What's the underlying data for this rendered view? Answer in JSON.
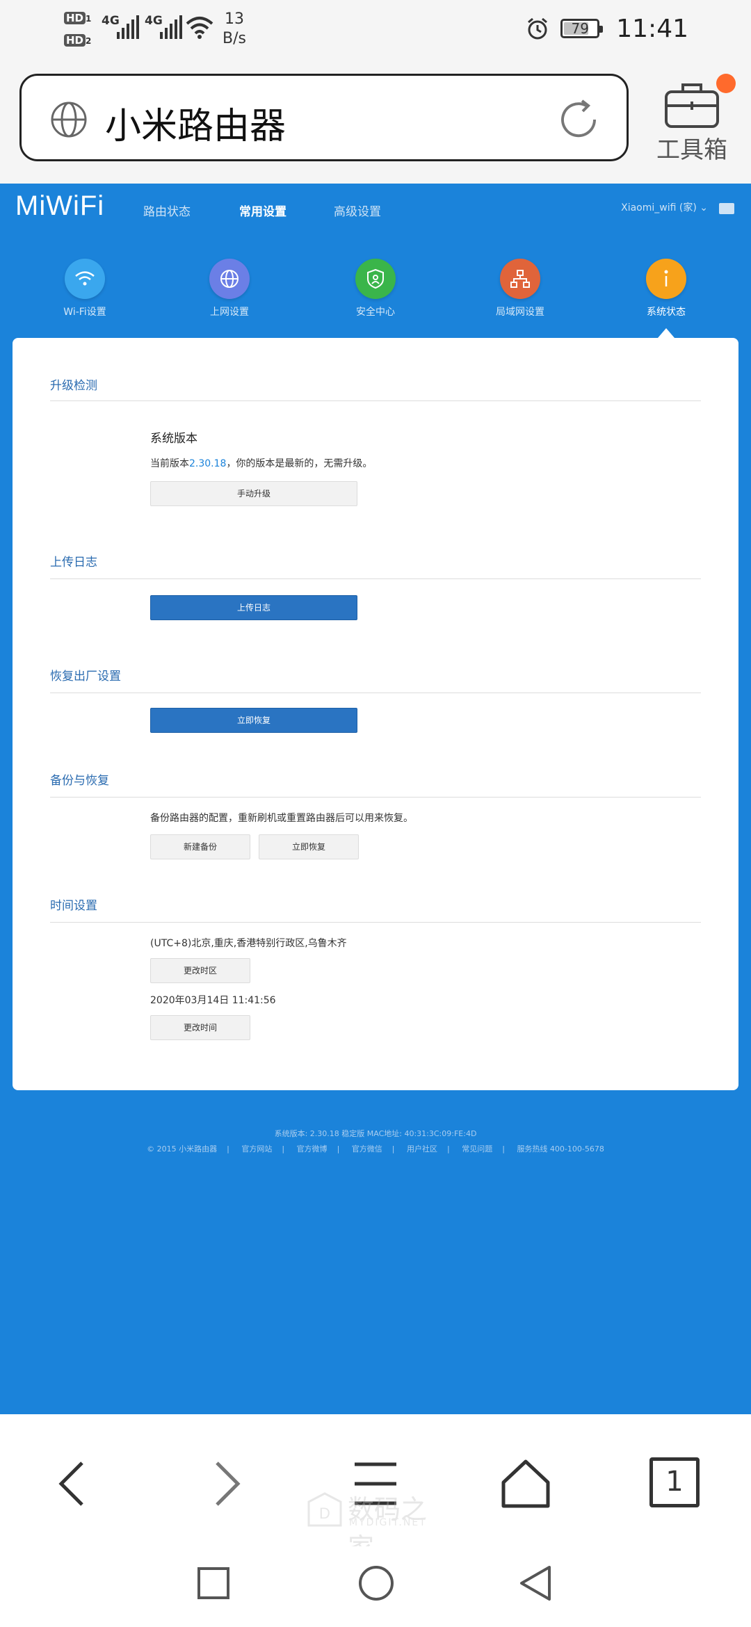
{
  "status_bar": {
    "hd1": "HD",
    "hd1_sub": "1",
    "hd2": "HD",
    "hd2_sub": "2",
    "net1": "4G",
    "net2": "4G",
    "speed_value": "13",
    "speed_unit": "B/s",
    "battery": "79",
    "time": "11:41"
  },
  "browser": {
    "address_text": "小米路由器",
    "toolbox_label": "工具箱"
  },
  "router": {
    "logo": "MiWiFi",
    "nav": [
      "路由状态",
      "常用设置",
      "高级设置"
    ],
    "active_nav": "常用设置",
    "user": "Xiaomi_wifi (家) ⌄",
    "quick_menu": [
      {
        "label": "Wi-Fi设置",
        "color": "#3aa7ee",
        "icon": "wifi-icon"
      },
      {
        "label": "上网设置",
        "color": "#6b7fe6",
        "icon": "globe-icon"
      },
      {
        "label": "安全中心",
        "color": "#3ab54a",
        "icon": "shield-icon"
      },
      {
        "label": "局域网设置",
        "color": "#e0643a",
        "icon": "network-icon"
      },
      {
        "label": "系统状态",
        "color": "#f7a21b",
        "icon": "info-icon"
      }
    ],
    "sections": {
      "upgrade": {
        "title": "升级检测",
        "subtitle": "系统版本",
        "line_prefix": "当前版本",
        "version": "2.30.18",
        "line_suffix": "，你的版本是最新的，无需升级。",
        "button": "手动升级"
      },
      "log": {
        "title": "上传日志",
        "button": "上传日志"
      },
      "reset": {
        "title": "恢复出厂设置",
        "button": "立即恢复"
      },
      "backup": {
        "title": "备份与恢复",
        "desc": "备份路由器的配置，重新刷机或重置路由器后可以用来恢复。",
        "button_backup": "新建备份",
        "button_restore": "立即恢复"
      },
      "time": {
        "title": "时间设置",
        "timezone": "(UTC+8)北京,重庆,香港特别行政区,乌鲁木齐",
        "button_zone": "更改时区",
        "datetime": "2020年03月14日 11:41:56",
        "button_time": "更改时间"
      }
    },
    "footer": {
      "line1": "系统版本: 2.30.18 稳定版 MAC地址: 40:31:3C:09:FE:4D",
      "links": [
        "© 2015 小米路由器",
        "官方网站",
        "官方微博",
        "官方微信",
        "用户社区",
        "常见问题",
        "服务热线 400-100-5678"
      ]
    }
  },
  "bottom_bar": {
    "tab_count": "1"
  },
  "watermark": {
    "text": "数码之家",
    "sub": "MYDIGIT.NET"
  }
}
